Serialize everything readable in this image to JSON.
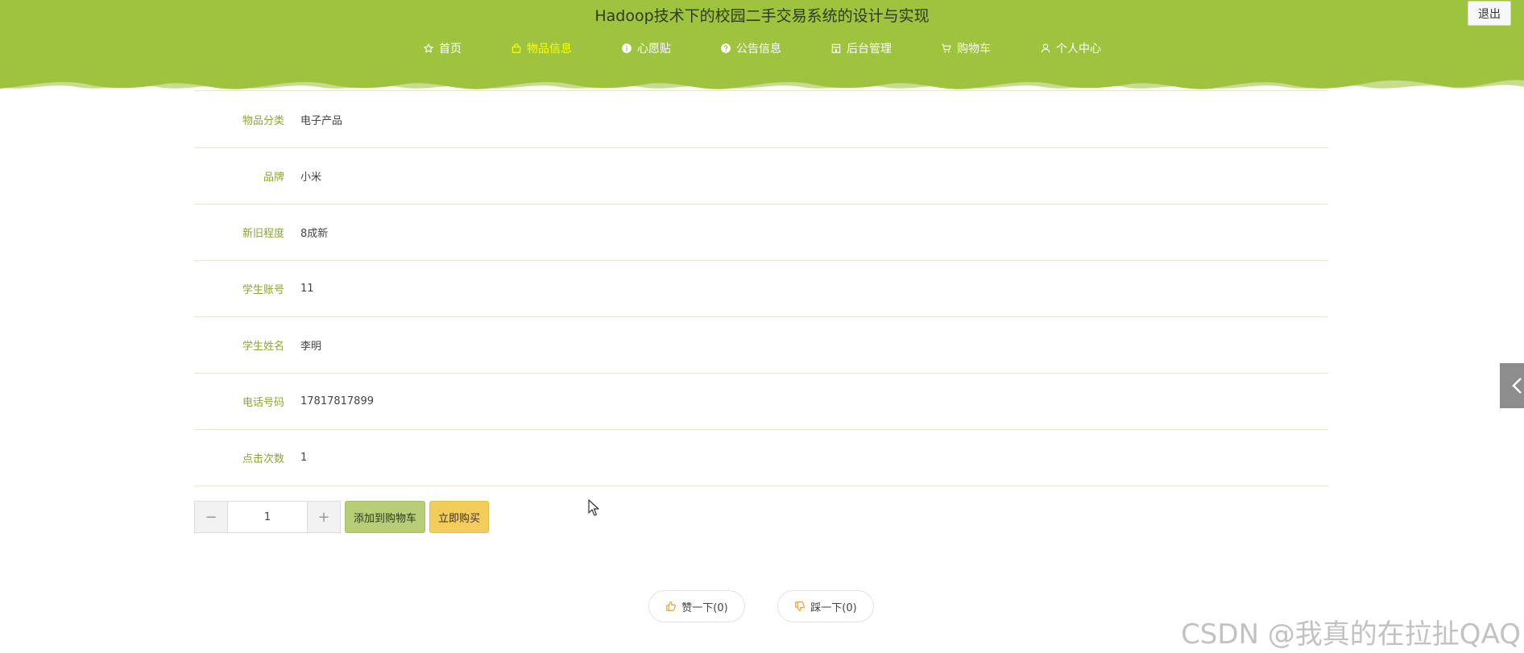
{
  "header": {
    "title": "Hadoop技术下的校园二手交易系统的设计与实现",
    "logout_label": "退出",
    "bg_color": "#9dc33f",
    "nav": [
      {
        "label": "首页",
        "icon": "star-icon",
        "active": false
      },
      {
        "label": "物品信息",
        "icon": "bag-icon",
        "active": true
      },
      {
        "label": "心愿贴",
        "icon": "info-icon",
        "active": false
      },
      {
        "label": "公告信息",
        "icon": "question-icon",
        "active": false
      },
      {
        "label": "后台管理",
        "icon": "building-icon",
        "active": false
      },
      {
        "label": "购物车",
        "icon": "cart-icon",
        "active": false
      },
      {
        "label": "个人中心",
        "icon": "user-icon",
        "active": false
      }
    ]
  },
  "details": [
    {
      "label": "物品分类",
      "value": "电子产品"
    },
    {
      "label": "品牌",
      "value": "小米"
    },
    {
      "label": "新旧程度",
      "value": "8成新"
    },
    {
      "label": "学生账号",
      "value": "11"
    },
    {
      "label": "学生姓名",
      "value": "李明"
    },
    {
      "label": "电话号码",
      "value": "17817817899"
    },
    {
      "label": "点击次数",
      "value": "1"
    }
  ],
  "actions": {
    "quantity": "1",
    "minus_label": "−",
    "plus_label": "+",
    "add_to_cart_label": "添加到购物车",
    "buy_now_label": "立即购买"
  },
  "votes": {
    "up_label": "赞一下(0)",
    "down_label": "踩一下(0)"
  },
  "watermark": "CSDN @我真的在拉扯QAQ"
}
